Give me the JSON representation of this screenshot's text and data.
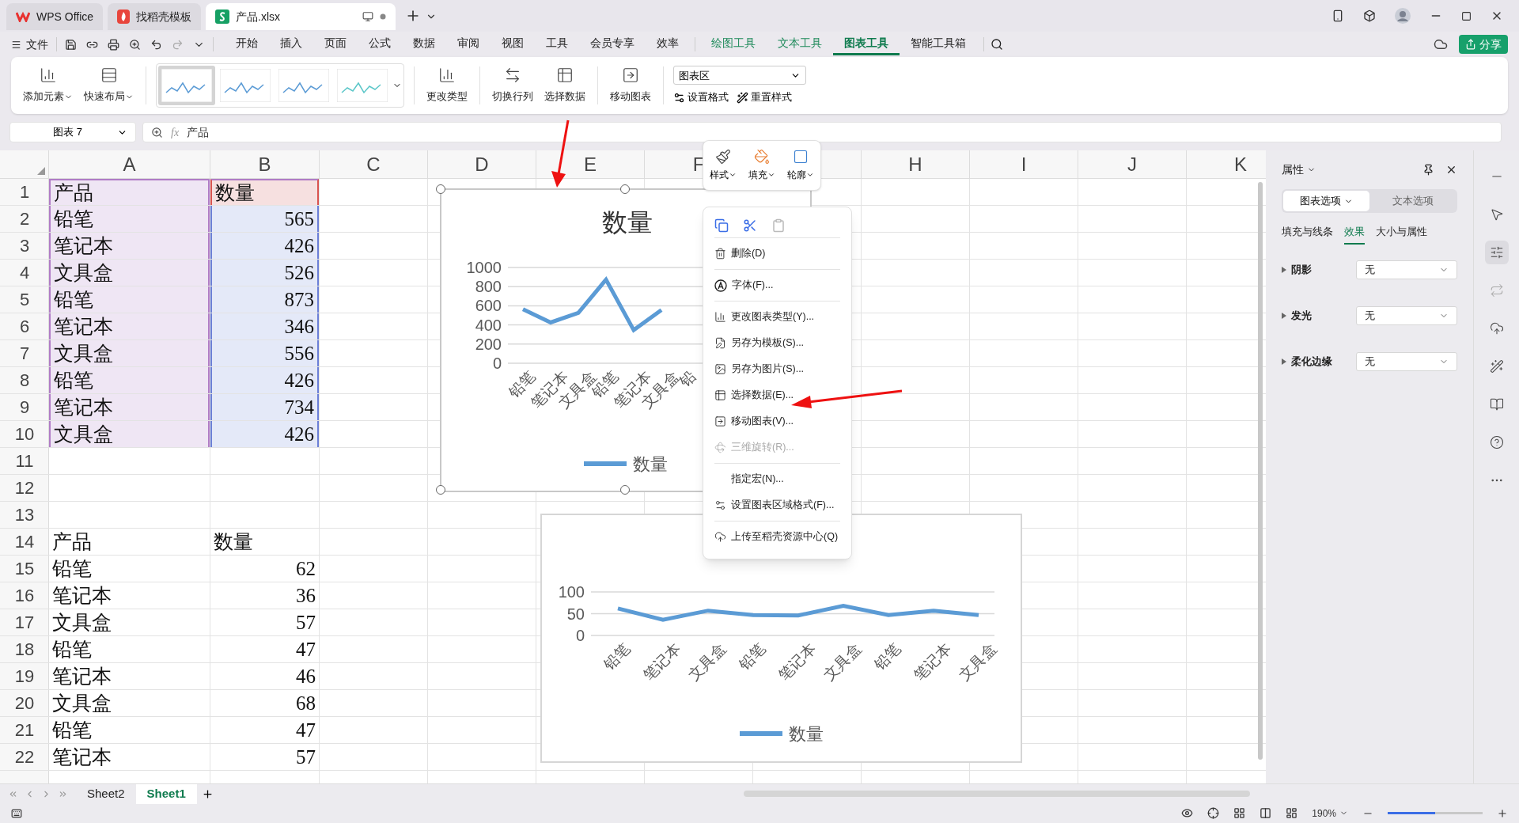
{
  "tabs": [
    {
      "label": "WPS Office",
      "selected": false,
      "kind": "wps"
    },
    {
      "label": "找稻壳模板",
      "selected": false,
      "kind": "docer"
    },
    {
      "label": "产品.xlsx",
      "selected": true,
      "kind": "sheet"
    }
  ],
  "menu_bar": {
    "file": "文件",
    "items": [
      {
        "label": "开始",
        "kind": "main",
        "selected": false
      },
      {
        "label": "插入",
        "kind": "main",
        "selected": false
      },
      {
        "label": "页面",
        "kind": "main",
        "selected": false
      },
      {
        "label": "公式",
        "kind": "main",
        "selected": false
      },
      {
        "label": "数据",
        "kind": "main",
        "selected": false
      },
      {
        "label": "审阅",
        "kind": "main",
        "selected": false
      },
      {
        "label": "视图",
        "kind": "main",
        "selected": false
      },
      {
        "label": "工具",
        "kind": "main",
        "selected": false
      },
      {
        "label": "会员专享",
        "kind": "main",
        "selected": false
      },
      {
        "label": "效率",
        "kind": "main",
        "selected": false
      },
      {
        "label": "绘图工具",
        "kind": "context",
        "selected": false
      },
      {
        "label": "文本工具",
        "kind": "context",
        "selected": false
      },
      {
        "label": "图表工具",
        "kind": "context",
        "selected": true
      },
      {
        "label": "智能工具箱",
        "kind": "main",
        "selected": false
      }
    ],
    "share": "分享"
  },
  "ribbon": {
    "buttons_left": [
      {
        "label": "添加元素",
        "dropdown": true
      },
      {
        "label": "快速布局",
        "dropdown": true
      }
    ],
    "chart_styles": [
      {
        "selected": true
      },
      {
        "selected": false
      },
      {
        "selected": false
      },
      {
        "selected": false
      }
    ],
    "button_groups": [
      [
        {
          "label": "更改类型",
          "dropdown": false
        }
      ],
      [
        {
          "label": "切换行列",
          "dropdown": false
        },
        {
          "label": "选择数据",
          "dropdown": false
        }
      ],
      [
        {
          "label": "移动图表",
          "dropdown": false
        }
      ]
    ],
    "element_select": "图表区",
    "small_buttons": [
      "设置格式",
      "重置样式"
    ]
  },
  "formula_bar": {
    "name_box": "图表 7",
    "fx": "fx",
    "content": "产品"
  },
  "sheet": {
    "columns": [
      "A",
      "B",
      "C",
      "D",
      "E",
      "F",
      "H",
      "I",
      "J",
      "K"
    ],
    "rows": [
      {
        "number": "1",
        "cells": [
          {
            "text": "产品",
            "kind": "category",
            "numeric": false
          },
          {
            "text": "数量",
            "kind": "series",
            "numeric": false
          }
        ]
      },
      {
        "number": "2",
        "cells": [
          {
            "text": "铅笔",
            "kind": "category",
            "numeric": false
          },
          {
            "text": "565",
            "kind": "values",
            "numeric": true
          }
        ]
      },
      {
        "number": "3",
        "cells": [
          {
            "text": "笔记本",
            "kind": "category",
            "numeric": false
          },
          {
            "text": "426",
            "kind": "values",
            "numeric": true
          }
        ]
      },
      {
        "number": "4",
        "cells": [
          {
            "text": "文具盒",
            "kind": "category",
            "numeric": false
          },
          {
            "text": "526",
            "kind": "values",
            "numeric": true
          }
        ]
      },
      {
        "number": "5",
        "cells": [
          {
            "text": "铅笔",
            "kind": "category",
            "numeric": false
          },
          {
            "text": "873",
            "kind": "values",
            "numeric": true
          }
        ]
      },
      {
        "number": "6",
        "cells": [
          {
            "text": "笔记本",
            "kind": "category",
            "numeric": false
          },
          {
            "text": "346",
            "kind": "values",
            "numeric": true
          }
        ]
      },
      {
        "number": "7",
        "cells": [
          {
            "text": "文具盒",
            "kind": "category",
            "numeric": false
          },
          {
            "text": "556",
            "kind": "values",
            "numeric": true
          }
        ]
      },
      {
        "number": "8",
        "cells": [
          {
            "text": "铅笔",
            "kind": "category",
            "numeric": false
          },
          {
            "text": "426",
            "kind": "values",
            "numeric": true
          }
        ]
      },
      {
        "number": "9",
        "cells": [
          {
            "text": "笔记本",
            "kind": "category",
            "numeric": false
          },
          {
            "text": "734",
            "kind": "values",
            "numeric": true
          }
        ]
      },
      {
        "number": "10",
        "cells": [
          {
            "text": "文具盒",
            "kind": "category",
            "numeric": false
          },
          {
            "text": "426",
            "kind": "values",
            "numeric": true
          }
        ]
      },
      {
        "number": "11",
        "cells": []
      },
      {
        "number": "12",
        "cells": []
      },
      {
        "number": "13",
        "cells": []
      },
      {
        "number": "14",
        "cells": [
          {
            "text": "产品",
            "kind": "plain",
            "numeric": false
          },
          {
            "text": "数量",
            "kind": "plain",
            "numeric": false
          }
        ]
      },
      {
        "number": "15",
        "cells": [
          {
            "text": "铅笔",
            "kind": "plain",
            "numeric": false
          },
          {
            "text": "62",
            "kind": "plain",
            "numeric": true
          }
        ]
      },
      {
        "number": "16",
        "cells": [
          {
            "text": "笔记本",
            "kind": "plain",
            "numeric": false
          },
          {
            "text": "36",
            "kind": "plain",
            "numeric": true
          }
        ]
      },
      {
        "number": "17",
        "cells": [
          {
            "text": "文具盒",
            "kind": "plain",
            "numeric": false
          },
          {
            "text": "57",
            "kind": "plain",
            "numeric": true
          }
        ]
      },
      {
        "number": "18",
        "cells": [
          {
            "text": "铅笔",
            "kind": "plain",
            "numeric": false
          },
          {
            "text": "47",
            "kind": "plain",
            "numeric": true
          }
        ]
      },
      {
        "number": "19",
        "cells": [
          {
            "text": "笔记本",
            "kind": "plain",
            "numeric": false
          },
          {
            "text": "46",
            "kind": "plain",
            "numeric": true
          }
        ]
      },
      {
        "number": "20",
        "cells": [
          {
            "text": "文具盒",
            "kind": "plain",
            "numeric": false
          },
          {
            "text": "68",
            "kind": "plain",
            "numeric": true
          }
        ]
      },
      {
        "number": "21",
        "cells": [
          {
            "text": "铅笔",
            "kind": "plain",
            "numeric": false
          },
          {
            "text": "47",
            "kind": "plain",
            "numeric": true
          }
        ]
      },
      {
        "number": "22",
        "cells": [
          {
            "text": "笔记本",
            "kind": "plain",
            "numeric": false
          },
          {
            "text": "57",
            "kind": "plain",
            "numeric": true
          }
        ]
      }
    ]
  },
  "charts": [
    {
      "selected": true,
      "chart_data": {
        "type": "line",
        "title": "数量",
        "categories": [
          "铅笔",
          "笔记本",
          "文具盒",
          "铅笔",
          "笔记本",
          "文具盒",
          "铅"
        ],
        "series": [
          {
            "name": "数量",
            "color": "#5b9bd5",
            "values": [
              565,
              426,
              526,
              873,
              346,
              556,
              null
            ]
          }
        ],
        "ylim": [
          0,
          1000
        ],
        "yticks": [
          0,
          200,
          400,
          600,
          800,
          1000
        ],
        "grid": true
      }
    },
    {
      "selected": false,
      "chart_data": {
        "type": "line",
        "categories": [
          "铅笔",
          "笔记本",
          "文具盒",
          "铅笔",
          "笔记本",
          "文具盒",
          "铅笔",
          "笔记本",
          "文具盒"
        ],
        "series": [
          {
            "name": "数量",
            "color": "#5b9bd5",
            "values": [
              62,
              36,
              57,
              47,
              46,
              68,
              47,
              57,
              47
            ]
          }
        ],
        "ylim": [
          0,
          100
        ],
        "yticks": [
          0,
          50,
          100
        ],
        "grid": true
      }
    }
  ],
  "mini_toolbar": [
    "样式",
    "填充",
    "轮廓"
  ],
  "context_menu": {
    "quick_actions": [
      {
        "disabled": false
      },
      {
        "disabled": false
      },
      {
        "disabled": true
      }
    ],
    "groups": [
      [
        {
          "label": "删除(D)",
          "disabled": false
        }
      ],
      [
        {
          "label": "字体(F)...",
          "disabled": false
        }
      ],
      [
        {
          "label": "更改图表类型(Y)...",
          "disabled": false
        },
        {
          "label": "另存为模板(S)...",
          "disabled": false
        },
        {
          "label": "另存为图片(S)...",
          "disabled": false
        },
        {
          "label": "选择数据(E)...",
          "disabled": false
        },
        {
          "label": "移动图表(V)...",
          "disabled": false
        },
        {
          "label": "三维旋转(R)...",
          "disabled": true
        }
      ],
      [
        {
          "label": "指定宏(N)...",
          "disabled": false
        },
        {
          "label": "设置图表区域格式(F)...",
          "disabled": false
        }
      ],
      [
        {
          "label": "上传至稻壳资源中心(Q)",
          "disabled": false
        }
      ]
    ]
  },
  "properties_panel": {
    "title": "属性",
    "tabs": [
      {
        "label": "图表选项",
        "selected": true
      },
      {
        "label": "文本选项",
        "selected": false
      }
    ],
    "subtabs": [
      {
        "label": "填充与线条",
        "selected": false
      },
      {
        "label": "效果",
        "selected": true
      },
      {
        "label": "大小与属性",
        "selected": false
      }
    ],
    "rows": [
      {
        "label": "阴影",
        "value": "无"
      },
      {
        "label": "发光",
        "value": "无"
      },
      {
        "label": "柔化边缘",
        "value": "无"
      }
    ]
  },
  "sheet_tabs": [
    {
      "label": "Sheet2",
      "selected": false
    },
    {
      "label": "Sheet1",
      "selected": true
    }
  ],
  "status_bar": {
    "zoom": "190%",
    "zoom_slider": {
      "level": 0.5
    }
  }
}
